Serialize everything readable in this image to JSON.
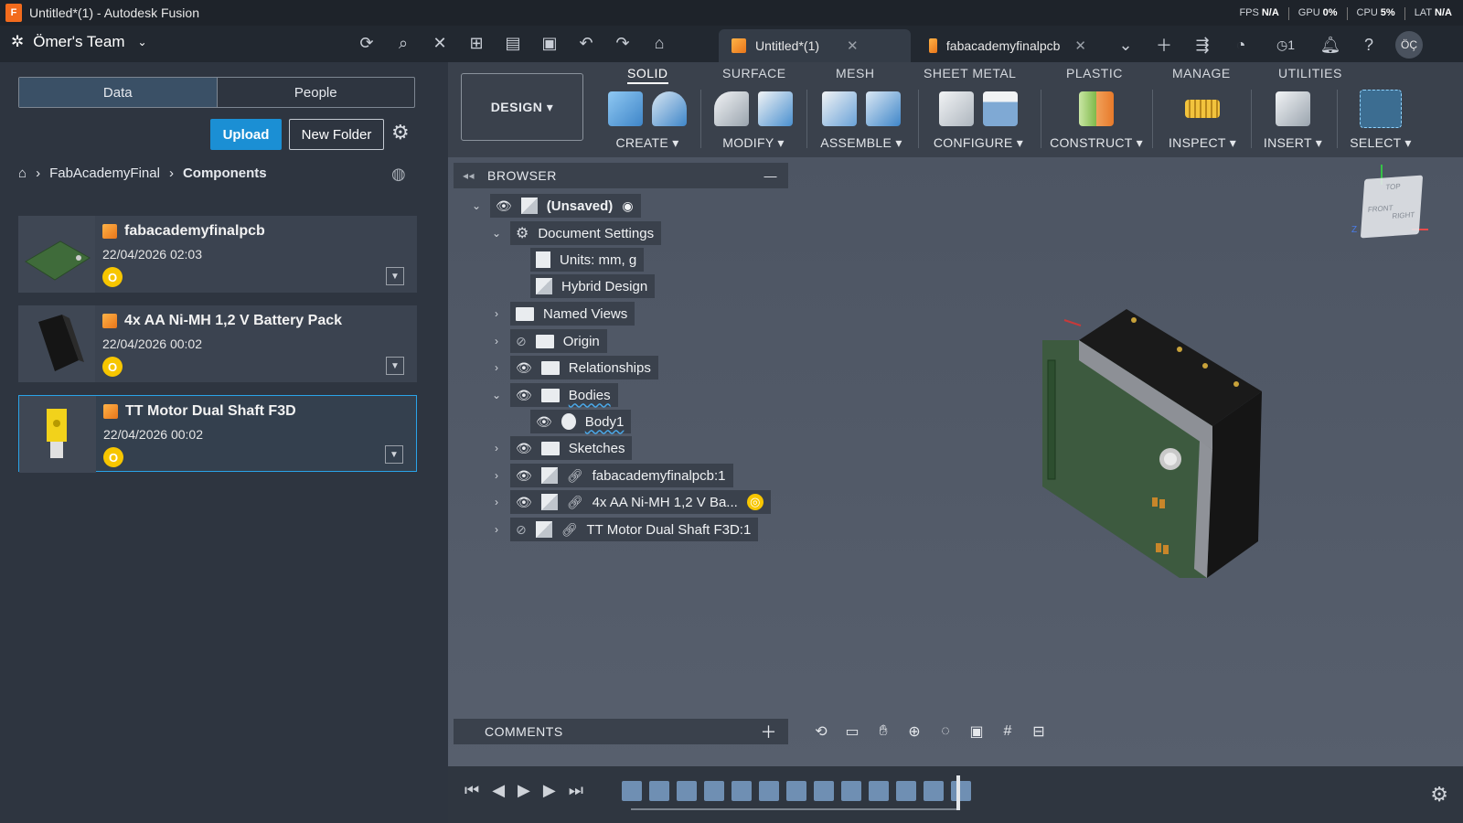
{
  "window": {
    "title": "Untitled*(1) - Autodesk Fusion",
    "app_icon_letter": "F"
  },
  "perf": [
    {
      "label": "FPS",
      "value": "N/A"
    },
    {
      "label": "GPU",
      "value": "0%"
    },
    {
      "label": "CPU",
      "value": "5%"
    },
    {
      "label": "LAT",
      "value": "N/A"
    }
  ],
  "team": {
    "name": "Ömer's Team"
  },
  "tabs": [
    {
      "label": "Untitled*(1)"
    },
    {
      "label": "fabacademyfinalpcb"
    }
  ],
  "user": {
    "initials": "ÖÇ",
    "jobs_count": "1"
  },
  "data_panel": {
    "seg_data": "Data",
    "seg_people": "People",
    "upload": "Upload",
    "new_folder": "New Folder",
    "breadcrumb": [
      "FabAcademyFinal",
      "Components"
    ],
    "items": [
      {
        "name": "fabacademyfinalpcb",
        "date": "22/04/2026 02:03",
        "badge": "O"
      },
      {
        "name": "4x AA Ni-MH 1,2 V Battery Pack",
        "date": "22/04/2026 00:02",
        "badge": "O"
      },
      {
        "name": "TT Motor Dual Shaft F3D",
        "date": "22/04/2026 00:02",
        "badge": "O"
      }
    ]
  },
  "ribbon": {
    "workspace": "DESIGN",
    "tabs": [
      "SOLID",
      "SURFACE",
      "MESH",
      "SHEET METAL",
      "PLASTIC",
      "MANAGE",
      "UTILITIES"
    ],
    "groups": [
      "CREATE",
      "MODIFY",
      "ASSEMBLE",
      "CONFIGURE",
      "CONSTRUCT",
      "INSPECT",
      "INSERT",
      "SELECT"
    ]
  },
  "browser": {
    "title": "BROWSER",
    "root": "(Unsaved)",
    "doc_settings": "Document Settings",
    "units": "Units: mm, g",
    "hybrid": "Hybrid Design",
    "named_views": "Named Views",
    "origin": "Origin",
    "relationships": "Relationships",
    "bodies": "Bodies",
    "body1": "Body1",
    "sketches": "Sketches",
    "comp1": "fabacademyfinalpcb:1",
    "comp2": "4x AA Ni-MH 1,2 V Ba...",
    "comp3": "TT Motor Dual Shaft F3D:1"
  },
  "viewcube": {
    "top": "TOP",
    "front": "FRONT",
    "right": "RIGHT"
  },
  "comments": {
    "title": "COMMENTS"
  }
}
